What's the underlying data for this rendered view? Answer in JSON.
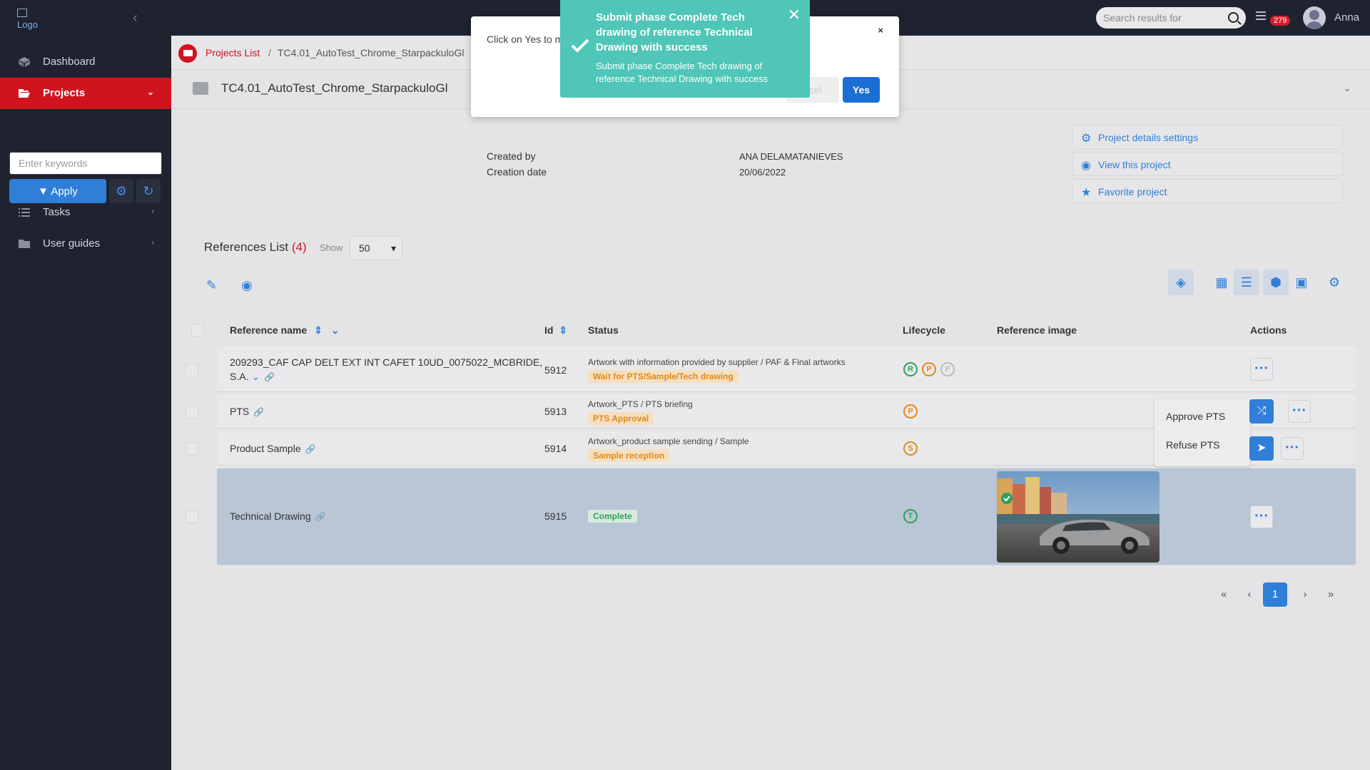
{
  "topbar": {
    "logo_alt": "Logo",
    "search_placeholder": "Search results for",
    "notification_count": "279",
    "username": "Anna"
  },
  "sidebar": {
    "items": [
      {
        "label": "Dashboard",
        "icon": "dashboard-icon"
      },
      {
        "label": "Projects",
        "icon": "folder-open-icon",
        "active": true
      },
      {
        "label": "Tasks",
        "icon": "list-icon"
      },
      {
        "label": "User guides",
        "icon": "folder-icon"
      }
    ],
    "keyword_placeholder": "Enter keywords",
    "apply_label": "Apply"
  },
  "breadcrumb": {
    "link": "Projects List",
    "separator": "/",
    "current": "TC4.01_AutoTest_Chrome_StarpackuloGl"
  },
  "project": {
    "title": "TC4.01_AutoTest_Chrome_StarpackuloGl",
    "meta": [
      {
        "label": "Created by",
        "value": "ANA DELAMATANIEVES"
      },
      {
        "label": "Creation date",
        "value": "20/06/2022"
      }
    ],
    "links": [
      {
        "label": "Project details settings",
        "icon": "gear-icon"
      },
      {
        "label": "View this project",
        "icon": "eye-icon"
      },
      {
        "label": "Favorite project",
        "icon": "star-icon"
      }
    ]
  },
  "references": {
    "title": "References List",
    "count": "(4)",
    "show_label": "Show",
    "show_value": "50",
    "columns": [
      "Reference name",
      "Id",
      "Status",
      "Lifecycle",
      "Reference image",
      "Actions"
    ],
    "rows": [
      {
        "name": "209293_CAF CAP DELT EXT INT CAFET 10UD_0075022_MCBRIDE, S.A.",
        "id": "5912",
        "status": "Artwork with information provided by supplier / PAF & Final artworks",
        "tag": "Wait for PTS/Sample/Tech drawing",
        "tag_color": "orange",
        "lifecycle": [
          "R",
          "P",
          "P"
        ]
      },
      {
        "name": "PTS",
        "id": "5913",
        "status": "Artwork_PTS / PTS briefing",
        "tag": "PTS Approval",
        "tag_color": "orange",
        "lifecycle": [
          "P"
        ]
      },
      {
        "name": "Product Sample",
        "id": "5914",
        "status": "Artwork_product sample sending / Sample",
        "tag": "Sample reception",
        "tag_color": "orange",
        "lifecycle": [
          "S"
        ]
      },
      {
        "name": "Technical Drawing",
        "id": "5915",
        "status": "",
        "tag": "Complete",
        "tag_color": "green",
        "lifecycle": [
          "T"
        ]
      }
    ],
    "action_menu": [
      "Approve PTS",
      "Refuse PTS"
    ]
  },
  "pagination": {
    "first": "«",
    "prev": "‹",
    "current": "1",
    "next": "›",
    "last": "»"
  },
  "modal": {
    "text": "Click on Yes to m",
    "close": "×",
    "cancel_label": "ncel",
    "yes_label": "Yes"
  },
  "toast": {
    "title": "Submit phase Complete Tech drawing of reference Technical Drawing with success",
    "message": "Submit phase Complete Tech drawing of reference Technical Drawing with success",
    "close": "✕"
  },
  "colors": {
    "accent_red": "#d0141d",
    "primary_blue": "#2f7fd8",
    "toast_teal": "#4fc6b7",
    "sidebar_bg": "#1f2330"
  }
}
